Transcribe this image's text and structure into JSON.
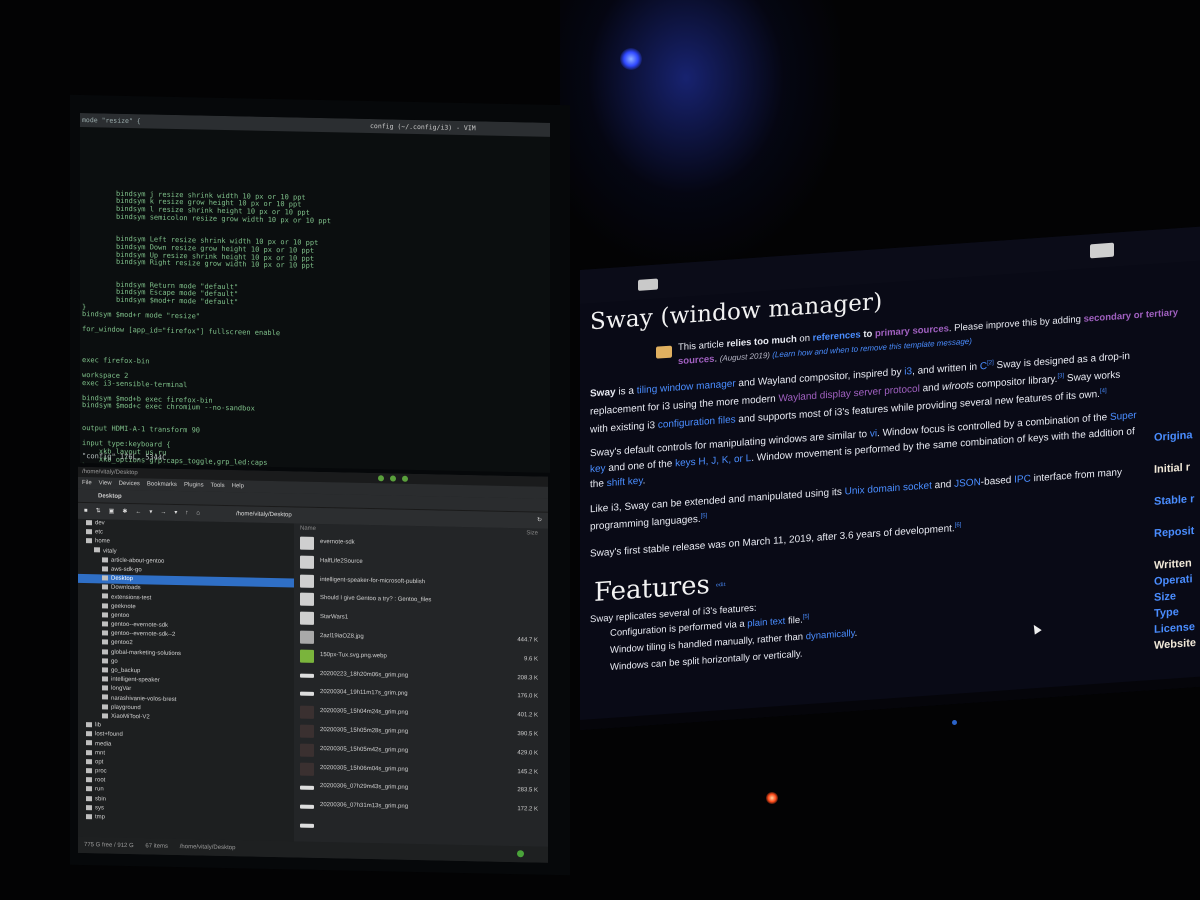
{
  "vim": {
    "mode_label": "mode \"resize\" {",
    "window_title": "config (~/.config/i3) - VIM",
    "lines": [
      {
        "text": "",
        "cls": ""
      },
      {
        "text": "",
        "cls": ""
      },
      {
        "text": "",
        "cls": ""
      },
      {
        "text": "",
        "cls": ""
      },
      {
        "text": "",
        "cls": ""
      },
      {
        "text": "",
        "cls": ""
      },
      {
        "text": "",
        "cls": ""
      },
      {
        "text": "",
        "cls": ""
      },
      {
        "text": "bindsym j resize shrink width 10 px or 10 ppt",
        "cls": "indent"
      },
      {
        "text": "bindsym k resize grow height 10 px or 10 ppt",
        "cls": "indent"
      },
      {
        "text": "bindsym l resize shrink height 10 px or 10 ppt",
        "cls": "indent"
      },
      {
        "text": "bindsym semicolon resize grow width 10 px or 10 ppt",
        "cls": "indent"
      },
      {
        "text": "",
        "cls": ""
      },
      {
        "text": "",
        "cls": ""
      },
      {
        "text": "bindsym Left resize shrink width 10 px or 10 ppt",
        "cls": "indent"
      },
      {
        "text": "bindsym Down resize grow height 10 px or 10 ppt",
        "cls": "indent"
      },
      {
        "text": "bindsym Up resize shrink height 10 px or 10 ppt",
        "cls": "indent"
      },
      {
        "text": "bindsym Right resize grow width 10 px or 10 ppt",
        "cls": "indent"
      },
      {
        "text": "",
        "cls": ""
      },
      {
        "text": "",
        "cls": ""
      },
      {
        "text": "bindsym Return mode \"default\"",
        "cls": "indent"
      },
      {
        "text": "bindsym Escape mode \"default\"",
        "cls": "indent"
      },
      {
        "text": "bindsym $mod+r mode \"default\"",
        "cls": "indent"
      },
      {
        "text": "}",
        "cls": ""
      },
      {
        "text": "bindsym $mod+r mode \"resize\"",
        "cls": ""
      },
      {
        "text": "",
        "cls": ""
      },
      {
        "text": "for_window [app_id=\"firefox\"] fullscreen enable",
        "cls": ""
      },
      {
        "text": "",
        "cls": ""
      },
      {
        "text": "",
        "cls": ""
      },
      {
        "text": "",
        "cls": ""
      },
      {
        "text": "exec firefox-bin",
        "cls": ""
      },
      {
        "text": "",
        "cls": ""
      },
      {
        "text": "workspace 2",
        "cls": ""
      },
      {
        "text": "exec i3-sensible-terminal",
        "cls": ""
      },
      {
        "text": "",
        "cls": ""
      },
      {
        "text": "bindsym $mod+b exec firefox-bin",
        "cls": ""
      },
      {
        "text": "bindsym $mod+c exec chromium --no-sandbox",
        "cls": ""
      },
      {
        "text": "",
        "cls": ""
      },
      {
        "text": "",
        "cls": ""
      },
      {
        "text": "output HDMI-A-1 transform 90",
        "cls": ""
      },
      {
        "text": "",
        "cls": ""
      },
      {
        "text": "input type:keyboard {",
        "cls": ""
      },
      {
        "text": "    xkb_layout us,ru",
        "cls": ""
      },
      {
        "text": "    xkb_options grp:caps_toggle,grp_led:caps",
        "cls": ""
      },
      {
        "text": "}",
        "cls": ""
      }
    ],
    "status_line": "\"config\" 176L, 5344C"
  },
  "file_manager": {
    "title": "/home/vitaly/Desktop",
    "menu": [
      "File",
      "View",
      "Devices",
      "Bookmarks",
      "Plugins",
      "Tools",
      "Help"
    ],
    "tab_label": "Desktop",
    "path": "/home/vitaly/Desktop",
    "tree": [
      {
        "label": "dev",
        "depth": 0,
        "selected": false
      },
      {
        "label": "etc",
        "depth": 0,
        "selected": false
      },
      {
        "label": "home",
        "depth": 0,
        "selected": false
      },
      {
        "label": "vitaly",
        "depth": 1,
        "selected": false
      },
      {
        "label": "article-about-gentoo",
        "depth": 2,
        "selected": false
      },
      {
        "label": "aws-sdk-go",
        "depth": 2,
        "selected": false
      },
      {
        "label": "Desktop",
        "depth": 2,
        "selected": true
      },
      {
        "label": "Downloads",
        "depth": 2,
        "selected": false
      },
      {
        "label": "extensions-test",
        "depth": 2,
        "selected": false
      },
      {
        "label": "geeknote",
        "depth": 2,
        "selected": false
      },
      {
        "label": "gentoo",
        "depth": 2,
        "selected": false
      },
      {
        "label": "gentoo--evernote-sdk",
        "depth": 2,
        "selected": false
      },
      {
        "label": "gentoo--evernote-sdk--2",
        "depth": 2,
        "selected": false
      },
      {
        "label": "gentoo2",
        "depth": 2,
        "selected": false
      },
      {
        "label": "global-marketing-solutions",
        "depth": 2,
        "selected": false
      },
      {
        "label": "go",
        "depth": 2,
        "selected": false
      },
      {
        "label": "go_backup",
        "depth": 2,
        "selected": false
      },
      {
        "label": "intelligent-speaker",
        "depth": 2,
        "selected": false
      },
      {
        "label": "longVar",
        "depth": 2,
        "selected": false
      },
      {
        "label": "narashivanie-volos-brest",
        "depth": 2,
        "selected": false
      },
      {
        "label": "playground",
        "depth": 2,
        "selected": false
      },
      {
        "label": "XiaoMiTool-V2",
        "depth": 2,
        "selected": false
      },
      {
        "label": "lib",
        "depth": 0,
        "selected": false
      },
      {
        "label": "lost+found",
        "depth": 0,
        "selected": false
      },
      {
        "label": "media",
        "depth": 0,
        "selected": false
      },
      {
        "label": "mnt",
        "depth": 0,
        "selected": false
      },
      {
        "label": "opt",
        "depth": 0,
        "selected": false
      },
      {
        "label": "proc",
        "depth": 0,
        "selected": false
      },
      {
        "label": "root",
        "depth": 0,
        "selected": false
      },
      {
        "label": "run",
        "depth": 0,
        "selected": false
      },
      {
        "label": "sbin",
        "depth": 0,
        "selected": false
      },
      {
        "label": "sys",
        "depth": 0,
        "selected": false
      },
      {
        "label": "tmp",
        "depth": 0,
        "selected": false
      }
    ],
    "list_header_name": "Name",
    "list_header_size": "Size",
    "files": [
      {
        "name": "evernote-sdk",
        "size": "",
        "thumb": "folder"
      },
      {
        "name": "HalfLife2Source",
        "size": "",
        "thumb": "folder"
      },
      {
        "name": "intelligent-speaker-for-microsoft-publish",
        "size": "",
        "thumb": "folder"
      },
      {
        "name": "Should I give Gentoo a try? : Gentoo_files",
        "size": "",
        "thumb": "folder"
      },
      {
        "name": "StarWars1",
        "size": "",
        "thumb": "folder"
      },
      {
        "name": "2azl19iaOZ8.jpg",
        "size": "444.7 K",
        "thumb": "img"
      },
      {
        "name": "150px-Tux.svg.png.webp",
        "size": "9.6 K",
        "thumb": "green"
      },
      {
        "name": "20200223_18h20m06s_grim.png",
        "size": "208.3 K",
        "thumb": "bar"
      },
      {
        "name": "20200304_19h11m17s_grim.png",
        "size": "176.0 K",
        "thumb": "bar"
      },
      {
        "name": "20200305_15h04m24s_grim.png",
        "size": "401.2 K",
        "thumb": "dark"
      },
      {
        "name": "20200305_15h05m28s_grim.png",
        "size": "390.5 K",
        "thumb": "dark"
      },
      {
        "name": "20200305_15h05m42s_grim.png",
        "size": "429.0 K",
        "thumb": "dark"
      },
      {
        "name": "20200305_15h06m04s_grim.png",
        "size": "145.2 K",
        "thumb": "dark"
      },
      {
        "name": "20200306_07h29m43s_grim.png",
        "size": "283.5 K",
        "thumb": "bar"
      },
      {
        "name": "20200306_07h31m13s_grim.png",
        "size": "172.2 K",
        "thumb": "bar"
      },
      {
        "name": "",
        "size": "",
        "thumb": "bar"
      }
    ],
    "status_free": "775 G free / 912 G",
    "status_items": "67 items",
    "status_path": "/home/vitaly/Desktop"
  },
  "wiki": {
    "title": "Sway (window manager)",
    "notice": {
      "lead": "This article ",
      "bold1": "relies too much",
      "mid1": " on ",
      "link1": "references",
      "mid2": " to ",
      "link2": "primary sources",
      "tail": ". Please improve this by adding ",
      "tail_link": "secondary or tertiary sources",
      "tail_end": ".",
      "date": "(August 2019)",
      "learn": "(Learn how and when to remove this template message)"
    },
    "p1": {
      "a": "Sway",
      "b": " is a ",
      "c": "tiling window manager",
      "d": " and Wayland compositor, inspired by ",
      "e": "i3",
      "f": ", and written in ",
      "g": "C",
      "h": "[2]",
      "i": " Sway is designed as a drop-in replacement for i3 using the more modern ",
      "j": "Wayland display server protocol",
      "k": " and ",
      "l": "wlroots",
      "m": " compositor library.",
      "n": "[3]",
      "o": " Sway works with existing i3 ",
      "p": "configuration files",
      "q": " and supports most of i3's features while providing several new features of its own.",
      "r": "[4]"
    },
    "p2": {
      "a": "Sway's default controls for manipulating windows are similar to ",
      "b": "vi",
      "c": ". Window focus is controlled by a combination of the ",
      "d": "Super key",
      "e": " and one of the ",
      "f": "keys H, J, K, or L",
      "g": ". Window movement is performed by the same combination of keys with the addition of the ",
      "h": "shift key",
      "i": "."
    },
    "p3": {
      "a": "Like i3, Sway can be extended and manipulated using its ",
      "b": "Unix domain socket",
      "c": " and ",
      "d": "JSON",
      "e": "-based ",
      "f": "IPC",
      "g": " interface from many programming languages.",
      "h": "[5]"
    },
    "p4": {
      "a": "Sway's first stable release was on March 11, 2019, after 3.6 years of development.",
      "b": "[6]"
    },
    "features_heading": "Features",
    "features_edit": "edit",
    "features_intro": "Sway replicates several of i3's features:",
    "bullets": [
      {
        "a": "Configuration is performed via a ",
        "b": "plain text",
        "c": " file.",
        "d": "[5]"
      },
      {
        "a": "Window tiling is handled manually, rather than ",
        "b": "dynamically",
        "c": ".",
        "d": ""
      },
      {
        "a": "Windows can be split horizontally or vertically.",
        "b": "",
        "c": "",
        "d": ""
      }
    ],
    "infobox": [
      {
        "label": "Origina",
        "color": "blue"
      },
      {
        "label": "",
        "color": "blue"
      },
      {
        "label": "Initial r",
        "color": "white"
      },
      {
        "label": "",
        "color": "blue"
      },
      {
        "label": "Stable r",
        "color": "blue"
      },
      {
        "label": "",
        "color": "blue"
      },
      {
        "label": "Reposit",
        "color": "blue"
      },
      {
        "label": "",
        "color": "blue"
      },
      {
        "label": "Written",
        "color": "white"
      },
      {
        "label": "Operati",
        "color": "blue"
      },
      {
        "label": "Size",
        "color": "blue"
      },
      {
        "label": "Type",
        "color": "blue"
      },
      {
        "label": "License",
        "color": "blue"
      },
      {
        "label": "Website",
        "color": "white"
      }
    ]
  }
}
